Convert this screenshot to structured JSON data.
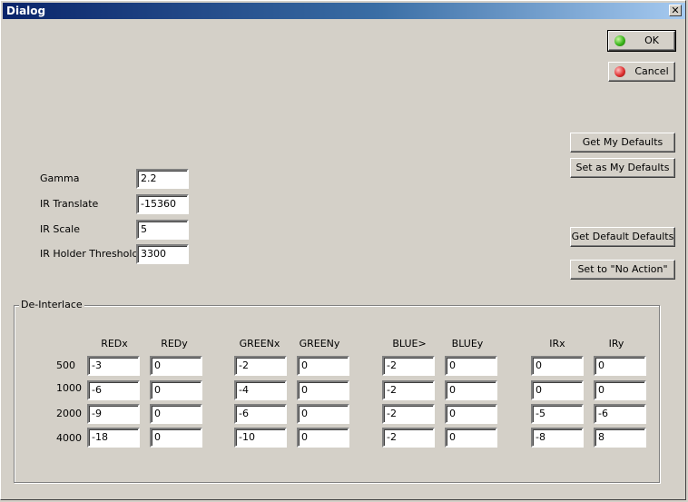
{
  "window": {
    "title": "Dialog",
    "close_glyph": "✕"
  },
  "buttons": {
    "ok": "OK",
    "cancel": "Cancel",
    "get_my_defaults": "Get My Defaults",
    "set_as_my_defaults": "Set as My Defaults",
    "get_default_defaults": "Get Default Defaults",
    "set_no_action": "Set to \"No Action\""
  },
  "params": [
    {
      "label": "Gamma",
      "value": "2.2"
    },
    {
      "label": "IR Translate",
      "value": "-15360"
    },
    {
      "label": "IR Scale",
      "value": "5"
    },
    {
      "label": "IR Holder Threshold",
      "value": "3300"
    }
  ],
  "deinterlace": {
    "title": "De-Interlace",
    "columns": [
      "REDx",
      "REDy",
      "GREENx",
      "GREENy",
      "BLUE>",
      "BLUEy",
      "IRx",
      "IRy"
    ],
    "rows": [
      {
        "label": "500",
        "values": [
          "-3",
          "0",
          "-2",
          "0",
          "-2",
          "0",
          "0",
          "0"
        ]
      },
      {
        "label": "1000",
        "values": [
          "-6",
          "0",
          "-4",
          "0",
          "-2",
          "0",
          "0",
          "0"
        ]
      },
      {
        "label": "2000",
        "values": [
          "-9",
          "0",
          "-6",
          "0",
          "-2",
          "0",
          "-5",
          "-6"
        ]
      },
      {
        "label": "4000",
        "values": [
          "-18",
          "0",
          "-10",
          "0",
          "-2",
          "0",
          "-8",
          "8"
        ]
      }
    ]
  },
  "icons": {
    "ok": "green-light-icon",
    "cancel": "red-light-icon"
  }
}
